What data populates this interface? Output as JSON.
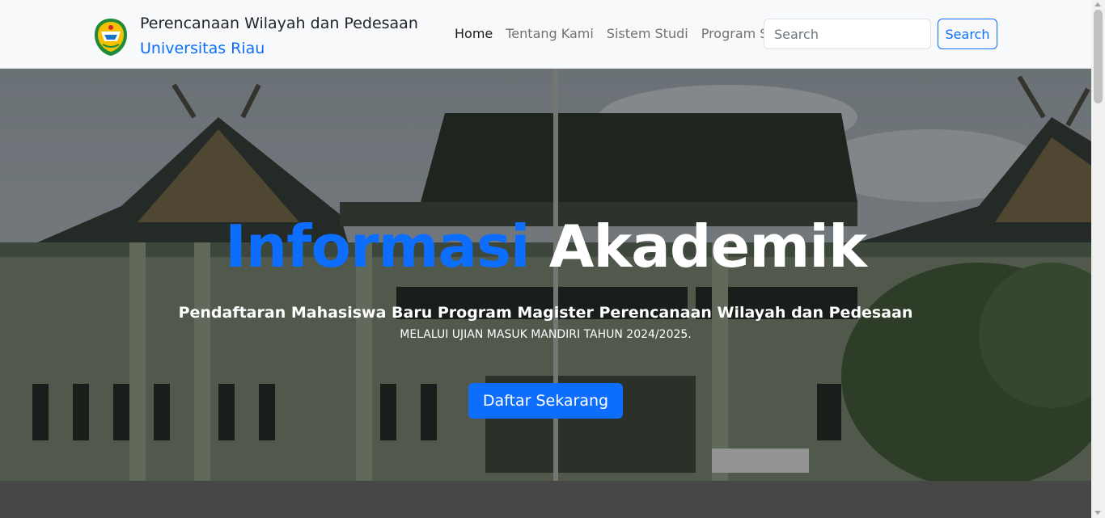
{
  "brand": {
    "title": "Perencanaan Wilayah dan Pedesaan",
    "subtitle": "Universitas Riau",
    "logo_icon": "university-crest-icon"
  },
  "nav": {
    "items": [
      {
        "label": "Home",
        "active": true
      },
      {
        "label": "Tentang Kami",
        "active": false
      },
      {
        "label": "Sistem Studi",
        "active": false
      },
      {
        "label": "Program Studi",
        "active": false
      }
    ]
  },
  "search": {
    "placeholder": "Search",
    "button_label": "Search"
  },
  "hero": {
    "title_part1": "Informasi",
    "title_part2": "Akademik",
    "subtitle": "Pendaftaran Mahasiswa Baru Program Magister Perencanaan Wilayah dan Pedesaan",
    "subtitle2": "MELALUI UJIAN MASUK MANDIRI TAHUN 2024/2025.",
    "cta_label": "Daftar Sekarang"
  },
  "colors": {
    "accent": "#0d6efd",
    "navbar_bg": "#f8f9fa"
  }
}
